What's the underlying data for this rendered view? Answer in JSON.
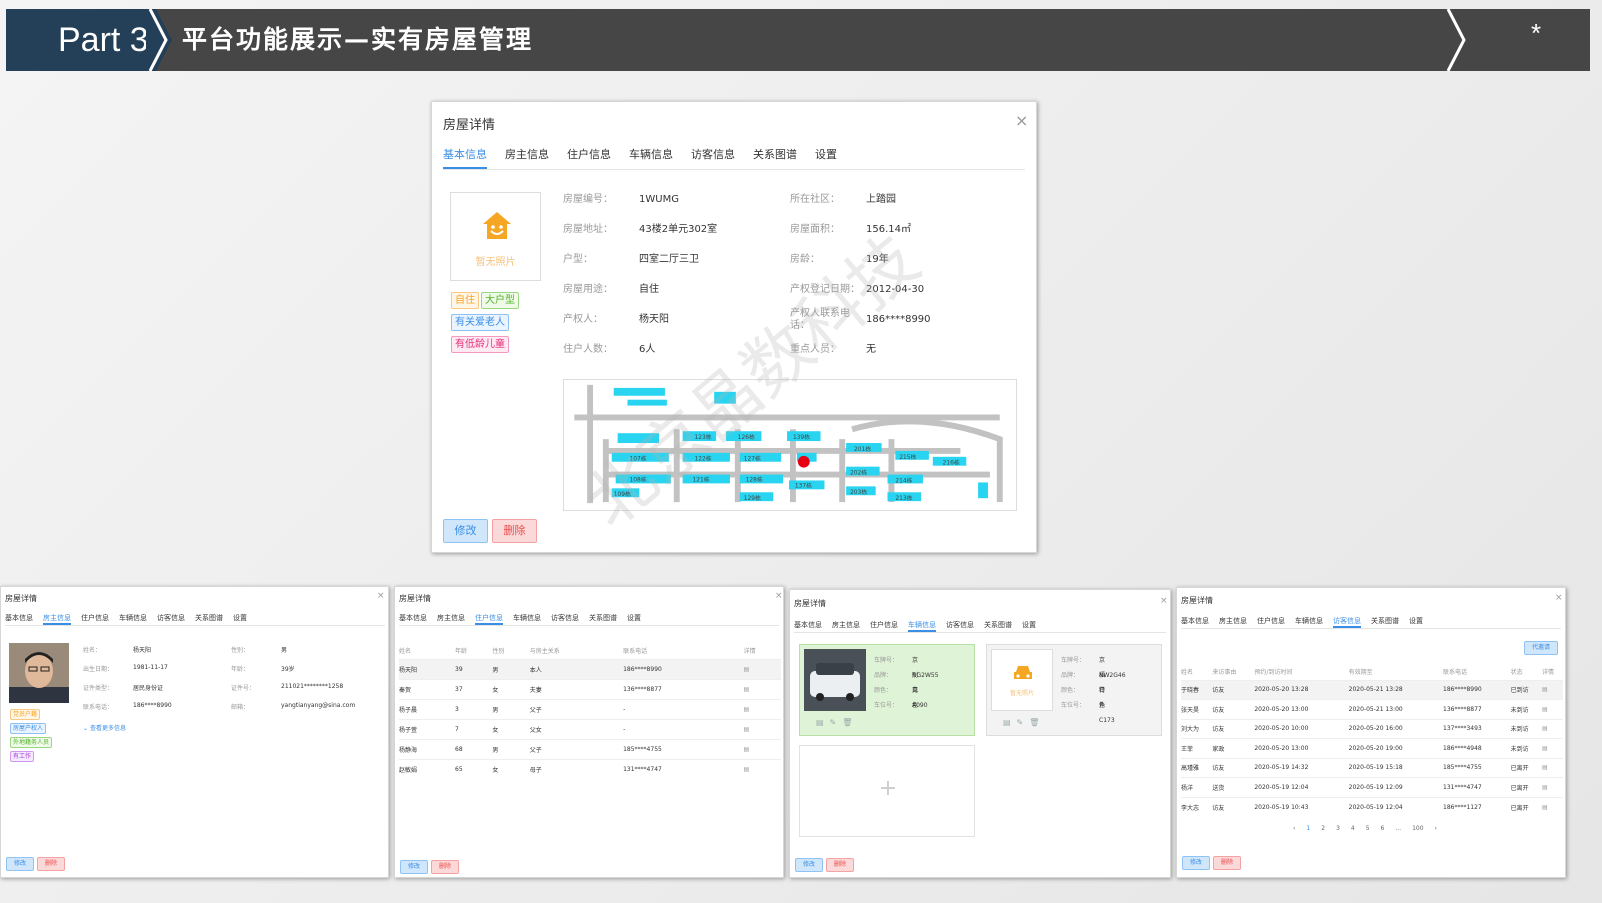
{
  "header": {
    "part": "Part 3",
    "title": "平台功能展示—实有房屋管理",
    "star": "*"
  },
  "watermark": "北京晶数科技",
  "main": {
    "title": "房屋详情",
    "close": "×",
    "tabs": [
      "基本信息",
      "房主信息",
      "住户信息",
      "车辆信息",
      "访客信息",
      "关系图谱",
      "设置"
    ],
    "photo_placeholder": "暂无照片",
    "tags": [
      "自住",
      "大户型",
      "有关爱老人",
      "有低龄儿童"
    ],
    "fields": [
      {
        "label": "房屋编号：",
        "value": "1WUMG"
      },
      {
        "label": "所在社区：",
        "value": "上踏园"
      },
      {
        "label": "房屋地址：",
        "value": "43楼2单元302室"
      },
      {
        "label": "房屋面积：",
        "value": "156.14㎡"
      },
      {
        "label": "户型：",
        "value": "四室二厅三卫"
      },
      {
        "label": "房龄：",
        "value": "19年"
      },
      {
        "label": "房屋用途：",
        "value": "自住"
      },
      {
        "label": "产权登记日期：",
        "value": "2012-04-30"
      },
      {
        "label": "产权人：",
        "value": "杨天阳"
      },
      {
        "label": "产权人联系电话：",
        "value": "186****8990"
      },
      {
        "label": "住户人数：",
        "value": "6人"
      },
      {
        "label": "重点人员：",
        "value": "无"
      }
    ],
    "map_labels": [
      "123栋",
      "126栋",
      "139栋",
      "107栋",
      "122栋",
      "127栋",
      "201栋",
      "215栋",
      "216栋",
      "108栋",
      "121栋",
      "128栋",
      "202栋",
      "214栋",
      "109栋",
      "137栋",
      "203栋",
      "213栋",
      "129栋"
    ],
    "edit": "修改",
    "delete": "删除"
  },
  "owner": {
    "title": "房屋详情",
    "close": "×",
    "fields": [
      {
        "label": "姓名：",
        "value": "杨天阳"
      },
      {
        "label": "性别：",
        "value": "男"
      },
      {
        "label": "出生日期：",
        "value": "1981-11-17"
      },
      {
        "label": "年龄：",
        "value": "39岁"
      },
      {
        "label": "证件类型：",
        "value": "居民身份证"
      },
      {
        "label": "证件号：",
        "value": "211021********1258"
      },
      {
        "label": "联系电话：",
        "value": "186****8990"
      },
      {
        "label": "邮箱：",
        "value": "yangtianyang@sina.com"
      }
    ],
    "tags": [
      "党员户籍",
      "房屋产权人",
      "外地籍务人员",
      "有工作"
    ],
    "more": "查看更多信息",
    "edit": "修改",
    "delete": "删除"
  },
  "residents": {
    "title": "房屋详情",
    "close": "×",
    "headers": [
      "姓名",
      "年龄",
      "性别",
      "与房主关系",
      "联系电话",
      "详情"
    ],
    "rows": [
      [
        "杨天阳",
        "39",
        "男",
        "本人",
        "186****8990"
      ],
      [
        "秦贺",
        "37",
        "女",
        "夫妻",
        "136****8877"
      ],
      [
        "杨子晨",
        "3",
        "男",
        "父子",
        "-"
      ],
      [
        "杨子萱",
        "7",
        "女",
        "父女",
        "-"
      ],
      [
        "杨静海",
        "68",
        "男",
        "父子",
        "185****4755"
      ],
      [
        "赵敏娟",
        "65",
        "女",
        "母子",
        "131****4747"
      ]
    ],
    "edit": "修改",
    "delete": "删除"
  },
  "vehicles": {
    "title": "房屋详情",
    "close": "×",
    "cars": [
      {
        "fields": [
          {
            "label": "车牌号：",
            "value": "京NG2W55"
          },
          {
            "label": "品牌：",
            "value": "别克"
          },
          {
            "label": "颜色：",
            "value": "白色"
          },
          {
            "label": "车位号：",
            "value": "A090"
          }
        ]
      },
      {
        "photo": "暂无照片",
        "fields": [
          {
            "label": "车牌号：",
            "value": "京NW2G46"
          },
          {
            "label": "品牌：",
            "value": "福特"
          },
          {
            "label": "颜色：",
            "value": "白色"
          },
          {
            "label": "车位号：",
            "value": "外C173"
          }
        ]
      }
    ],
    "add": "+",
    "edit": "修改",
    "delete": "删除"
  },
  "visitors": {
    "title": "房屋详情",
    "close": "×",
    "invite": "代邀请",
    "headers": [
      "姓名",
      "来访事由",
      "预约/到访时间",
      "有效期至",
      "联系电话",
      "状态",
      "详情"
    ],
    "rows": [
      [
        "于晓春",
        "访友",
        "2020-05-20 13:28",
        "2020-05-21 13:28",
        "186****8990",
        "已到访"
      ],
      [
        "张天昊",
        "访友",
        "2020-05-20 13:00",
        "2020-05-21 13:00",
        "136****8877",
        "未到访"
      ],
      [
        "刘大为",
        "访友",
        "2020-05-20 10:00",
        "2020-05-20 16:00",
        "137****3493",
        "未到访"
      ],
      [
        "王菲",
        "家政",
        "2020-05-20 13:00",
        "2020-05-20 19:00",
        "186****4948",
        "未到访"
      ],
      [
        "高瑾雅",
        "访友",
        "2020-05-19 14:32",
        "2020-05-19 15:18",
        "185****4755",
        "已离开"
      ],
      [
        "杨洋",
        "送货",
        "2020-05-19 12:04",
        "2020-05-19 12:09",
        "131****4747",
        "已离开"
      ],
      [
        "李大志",
        "访友",
        "2020-05-19 10:43",
        "2020-05-19 12:04",
        "186****1127",
        "已离开"
      ]
    ],
    "pager": [
      "‹",
      "1",
      "2",
      "3",
      "4",
      "5",
      "6",
      "...",
      "100",
      "›"
    ],
    "edit": "修改",
    "delete": "删除"
  },
  "colors": {
    "accent": "#3a8ee6",
    "header": "#464646",
    "part": "#243f58",
    "map_building": "#29d4f0",
    "map_road": "#bdbdbd",
    "marker": "#e60012"
  }
}
